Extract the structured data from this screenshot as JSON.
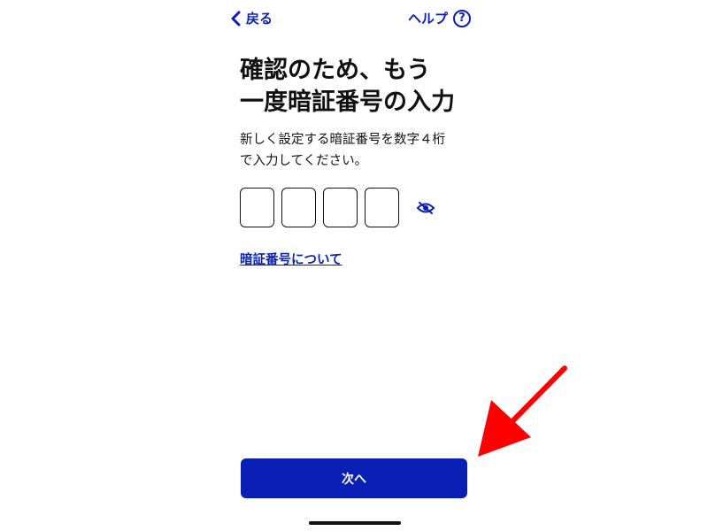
{
  "nav": {
    "back_label": "戻る",
    "help_label": "ヘルプ",
    "help_symbol": "?"
  },
  "title": {
    "lines": [
      "確認のため、もう",
      "一度暗証番号の入力"
    ]
  },
  "description": {
    "lines": [
      "新しく設定する暗証番号を数字４桁",
      "で入力してください。"
    ]
  },
  "pin": {
    "digits": [
      "",
      "",
      "",
      ""
    ],
    "visibility_icon": "eye-slash-icon"
  },
  "about_link": "暗証番号について",
  "next_button": "次へ",
  "colors": {
    "accent": "#0a1fb5",
    "text": "#111111",
    "annotation": "#ff0000"
  }
}
